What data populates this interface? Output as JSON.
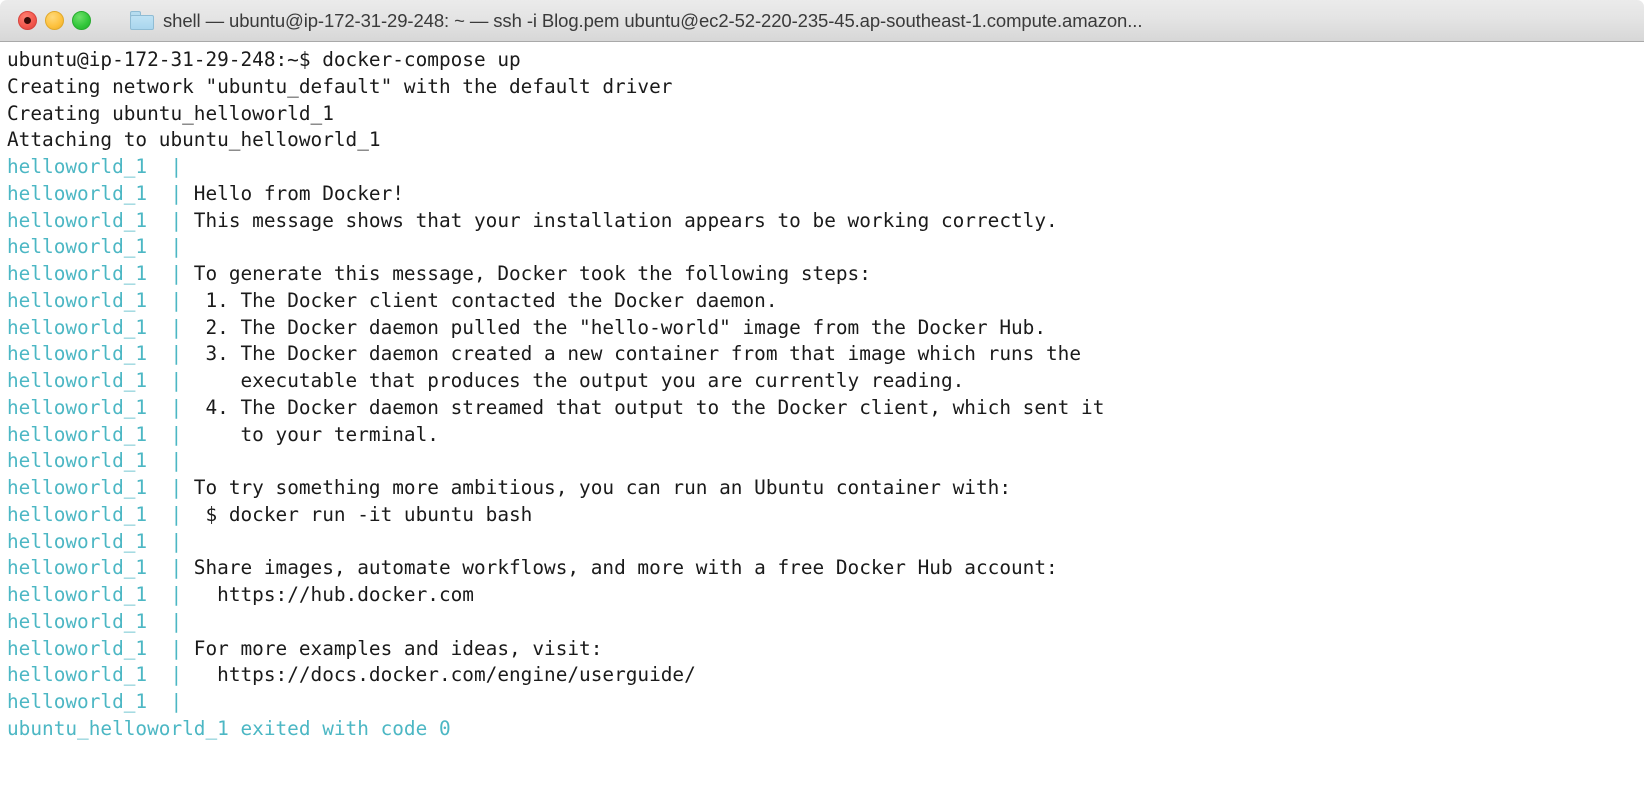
{
  "window": {
    "title": "shell — ubuntu@ip-172-31-29-248: ~ — ssh -i Blog.pem ubuntu@ec2-52-220-235-45.ap-southeast-1.compute.amazon...",
    "traffic_lights": {
      "close_label": "close",
      "minimize_label": "minimize",
      "maximize_label": "maximize"
    },
    "folder_icon": "folder-icon"
  },
  "colors": {
    "titlebar_top": "#ebebeb",
    "titlebar_bottom": "#d7d7d7",
    "titlebar_border": "#a9a9a9",
    "terminal_background": "#ffffff",
    "terminal_text": "#1a1a1a",
    "container_prefix": "#4cb7c4",
    "close_button": "#f2574d",
    "minimize_button": "#fdc13d",
    "maximize_button": "#31c639",
    "folder_icon": "#a9d6ee"
  },
  "terminal": {
    "prompt": "ubuntu@ip-172-31-29-248:~$",
    "command": "docker-compose up",
    "container_label": "helloworld_1",
    "pipe": "|",
    "lines": [
      {
        "kind": "prompt",
        "prompt": "ubuntu@ip-172-31-29-248:~$ ",
        "text": "docker-compose up"
      },
      {
        "kind": "plain",
        "text": "Creating network \"ubuntu_default\" with the default driver"
      },
      {
        "kind": "plain",
        "text": "Creating ubuntu_helloworld_1"
      },
      {
        "kind": "plain",
        "text": "Attaching to ubuntu_helloworld_1"
      },
      {
        "kind": "container",
        "prefix": "helloworld_1",
        "pipe": "|",
        "text": ""
      },
      {
        "kind": "container",
        "prefix": "helloworld_1",
        "pipe": "|",
        "text": "Hello from Docker!"
      },
      {
        "kind": "container",
        "prefix": "helloworld_1",
        "pipe": "|",
        "text": "This message shows that your installation appears to be working correctly."
      },
      {
        "kind": "container",
        "prefix": "helloworld_1",
        "pipe": "|",
        "text": ""
      },
      {
        "kind": "container",
        "prefix": "helloworld_1",
        "pipe": "|",
        "text": "To generate this message, Docker took the following steps:"
      },
      {
        "kind": "container",
        "prefix": "helloworld_1",
        "pipe": "|",
        "text": " 1. The Docker client contacted the Docker daemon."
      },
      {
        "kind": "container",
        "prefix": "helloworld_1",
        "pipe": "|",
        "text": " 2. The Docker daemon pulled the \"hello-world\" image from the Docker Hub."
      },
      {
        "kind": "container",
        "prefix": "helloworld_1",
        "pipe": "|",
        "text": " 3. The Docker daemon created a new container from that image which runs the"
      },
      {
        "kind": "container",
        "prefix": "helloworld_1",
        "pipe": "|",
        "text": "    executable that produces the output you are currently reading."
      },
      {
        "kind": "container",
        "prefix": "helloworld_1",
        "pipe": "|",
        "text": " 4. The Docker daemon streamed that output to the Docker client, which sent it"
      },
      {
        "kind": "container",
        "prefix": "helloworld_1",
        "pipe": "|",
        "text": "    to your terminal."
      },
      {
        "kind": "container",
        "prefix": "helloworld_1",
        "pipe": "|",
        "text": ""
      },
      {
        "kind": "container",
        "prefix": "helloworld_1",
        "pipe": "|",
        "text": "To try something more ambitious, you can run an Ubuntu container with:"
      },
      {
        "kind": "container",
        "prefix": "helloworld_1",
        "pipe": "|",
        "text": " $ docker run -it ubuntu bash"
      },
      {
        "kind": "container",
        "prefix": "helloworld_1",
        "pipe": "|",
        "text": ""
      },
      {
        "kind": "container",
        "prefix": "helloworld_1",
        "pipe": "|",
        "text": "Share images, automate workflows, and more with a free Docker Hub account:"
      },
      {
        "kind": "container",
        "prefix": "helloworld_1",
        "pipe": "|",
        "text": "  https://hub.docker.com"
      },
      {
        "kind": "container",
        "prefix": "helloworld_1",
        "pipe": "|",
        "text": ""
      },
      {
        "kind": "container",
        "prefix": "helloworld_1",
        "pipe": "|",
        "text": "For more examples and ideas, visit:"
      },
      {
        "kind": "container",
        "prefix": "helloworld_1",
        "pipe": "|",
        "text": "  https://docs.docker.com/engine/userguide/"
      },
      {
        "kind": "container",
        "prefix": "helloworld_1",
        "pipe": "|",
        "text": ""
      },
      {
        "kind": "cyan",
        "text": "ubuntu_helloworld_1 exited with code 0"
      }
    ]
  }
}
